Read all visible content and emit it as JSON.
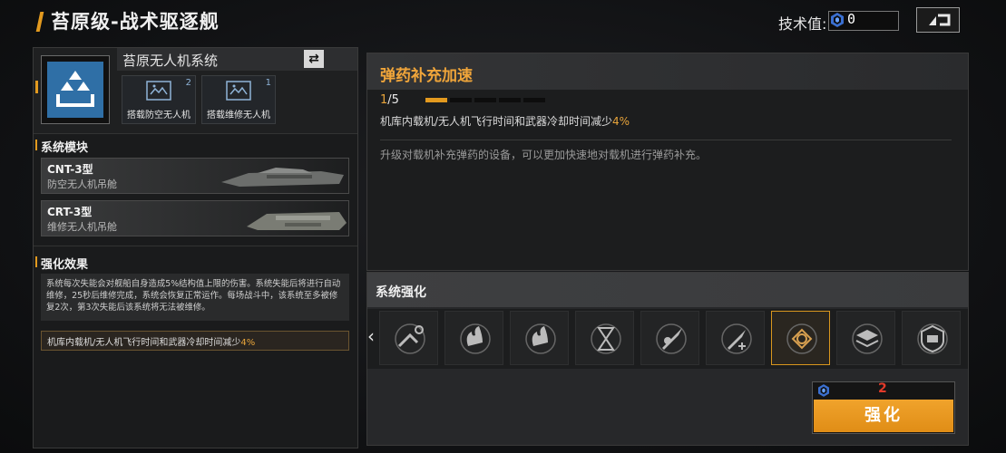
{
  "header": {
    "title": "苔原级-战术驱逐舰",
    "tech_label": "技术值:",
    "tech_value": "0",
    "back_icon": "back-icon"
  },
  "system": {
    "name": "苔原无人机系统",
    "swap_icon": "swap-icon",
    "drones": [
      {
        "label": "搭载防空无人机",
        "count": "2"
      },
      {
        "label": "搭载维修无人机",
        "count": "1"
      }
    ]
  },
  "modules_section": {
    "title": "系统模块",
    "items": [
      {
        "name": "CNT-3型",
        "sub": "防空无人机吊舱"
      },
      {
        "name": "CRT-3型",
        "sub": "维修无人机吊舱"
      }
    ]
  },
  "effect_section": {
    "title": "强化效果",
    "description": "系统每次失能会对舰船自身造成5%结构值上限的伤害。系统失能后将进行自动维修，25秒后维修完成，系统会恢复正常运作。每场战斗中，该系统至多被修复2次，第3次失能后该系统将无法被维修。",
    "bonus_text": "机库内载机/无人机飞行时间和武器冷却时间减少",
    "bonus_value": "4%"
  },
  "upgrade": {
    "title": "弹药补充加速",
    "level_current": "1",
    "level_max": "/5",
    "level_fraction": 0.2,
    "effect_text": "机库内载机/无人机飞行时间和武器冷却时间减少",
    "effect_value": "4%",
    "flavor": "升级对载机补充弹药的设备，可以更加快速地对载机进行弹药补充。"
  },
  "enhance": {
    "title": "系统强化",
    "selected_index": 6,
    "slots": [
      "drone-plus-icon",
      "fire-icon",
      "fire-icon",
      "hourglass-drone-icon",
      "missile-icon",
      "missile-plus-icon",
      "drone-reload-icon",
      "layers-icon",
      "shield-drone-icon"
    ],
    "cost": "2",
    "button_label": "强化"
  },
  "colors": {
    "accent": "#e39a1f",
    "cost_red": "#e23a2a"
  }
}
